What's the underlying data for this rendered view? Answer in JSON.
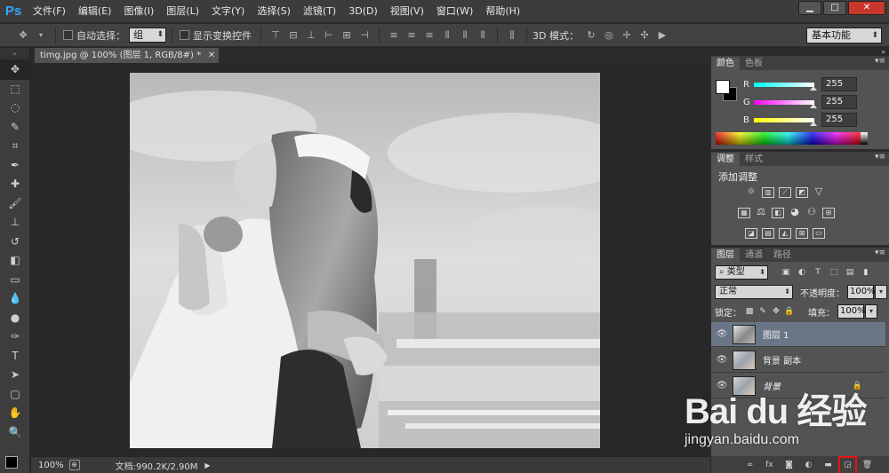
{
  "app": {
    "logo": "Ps"
  },
  "menu": [
    "文件(F)",
    "编辑(E)",
    "图像(I)",
    "图层(L)",
    "文字(Y)",
    "选择(S)",
    "滤镜(T)",
    "3D(D)",
    "视图(V)",
    "窗口(W)",
    "帮助(H)"
  ],
  "options_bar": {
    "auto_select_label": "自动选择：",
    "auto_select_value": "组",
    "show_transform_label": "显示变换控件",
    "mode_3d_label": "3D 模式：",
    "workspace": "基本功能"
  },
  "document": {
    "tab_title": "timg.jpg @ 100% (图层 1, RGB/8#) *",
    "zoom": "100%",
    "doc_size": "文档:990.2K/2.90M"
  },
  "color_panel": {
    "tabs": [
      "颜色",
      "色板"
    ],
    "sliders": [
      {
        "label": "R",
        "value": "255",
        "color": "#00e5e5"
      },
      {
        "label": "G",
        "value": "255",
        "color": "#e500e5"
      },
      {
        "label": "B",
        "value": "255",
        "color": "#e5e500"
      }
    ]
  },
  "adjustments_panel": {
    "tabs": [
      "调整",
      "样式"
    ],
    "title": "添加调整"
  },
  "layers_panel": {
    "tabs": [
      "图层",
      "通道",
      "路径"
    ],
    "filter_kind": "类型",
    "blend_mode": "正常",
    "opacity_label": "不透明度：",
    "opacity_value": "100%",
    "lock_label": "锁定：",
    "fill_label": "填充：",
    "fill_value": "100%",
    "layers": [
      {
        "name": "图层 1",
        "selected": true
      },
      {
        "name": "背景 副本",
        "selected": false
      },
      {
        "name": "背景",
        "selected": false,
        "locked": true
      }
    ]
  },
  "watermark": {
    "logo": "Bai du 经验",
    "url": "jingyan.baidu.com"
  }
}
